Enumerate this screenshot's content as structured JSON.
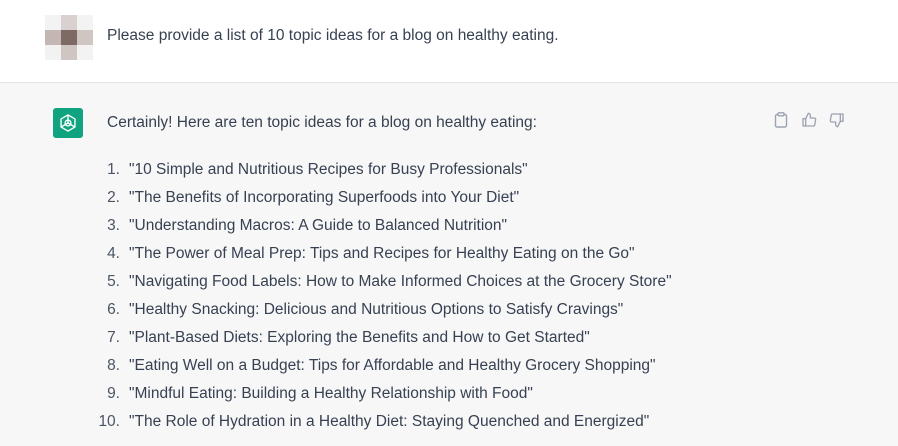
{
  "user": {
    "message": "Please provide a list of 10 topic ideas for a blog on healthy eating.",
    "avatar_colors": [
      "#f3f3f3",
      "#d9d1cf",
      "#f3f3f3",
      "#c4b7b3",
      "#7d6a64",
      "#cfc5c2",
      "#f2f2f2",
      "#cfc6c3",
      "#f3f3f3"
    ]
  },
  "assistant": {
    "icon": "openai-logo-icon",
    "icon_bg": "#10a37f",
    "intro": "Certainly! Here are ten topic ideas for a blog on healthy eating:",
    "actions": [
      {
        "name": "copy-icon"
      },
      {
        "name": "thumbs-up-icon"
      },
      {
        "name": "thumbs-down-icon"
      }
    ],
    "topics": [
      {
        "num": "1.",
        "text": "\"10 Simple and Nutritious Recipes for Busy Professionals\""
      },
      {
        "num": "2.",
        "text": "\"The Benefits of Incorporating Superfoods into Your Diet\""
      },
      {
        "num": "3.",
        "text": "\"Understanding Macros: A Guide to Balanced Nutrition\""
      },
      {
        "num": "4.",
        "text": "\"The Power of Meal Prep: Tips and Recipes for Healthy Eating on the Go\""
      },
      {
        "num": "5.",
        "text": "\"Navigating Food Labels: How to Make Informed Choices at the Grocery Store\""
      },
      {
        "num": "6.",
        "text": "\"Healthy Snacking: Delicious and Nutritious Options to Satisfy Cravings\""
      },
      {
        "num": "7.",
        "text": "\"Plant-Based Diets: Exploring the Benefits and How to Get Started\""
      },
      {
        "num": "8.",
        "text": "\"Eating Well on a Budget: Tips for Affordable and Healthy Grocery Shopping\""
      },
      {
        "num": "9.",
        "text": "\"Mindful Eating: Building a Healthy Relationship with Food\""
      },
      {
        "num": "10.",
        "text": "\"The Role of Hydration in a Healthy Diet: Staying Quenched and Energized\""
      }
    ]
  },
  "colors": {
    "text": "#374151",
    "assistant_bg": "#f7f7f8",
    "icon_gray": "#9ca3af"
  }
}
